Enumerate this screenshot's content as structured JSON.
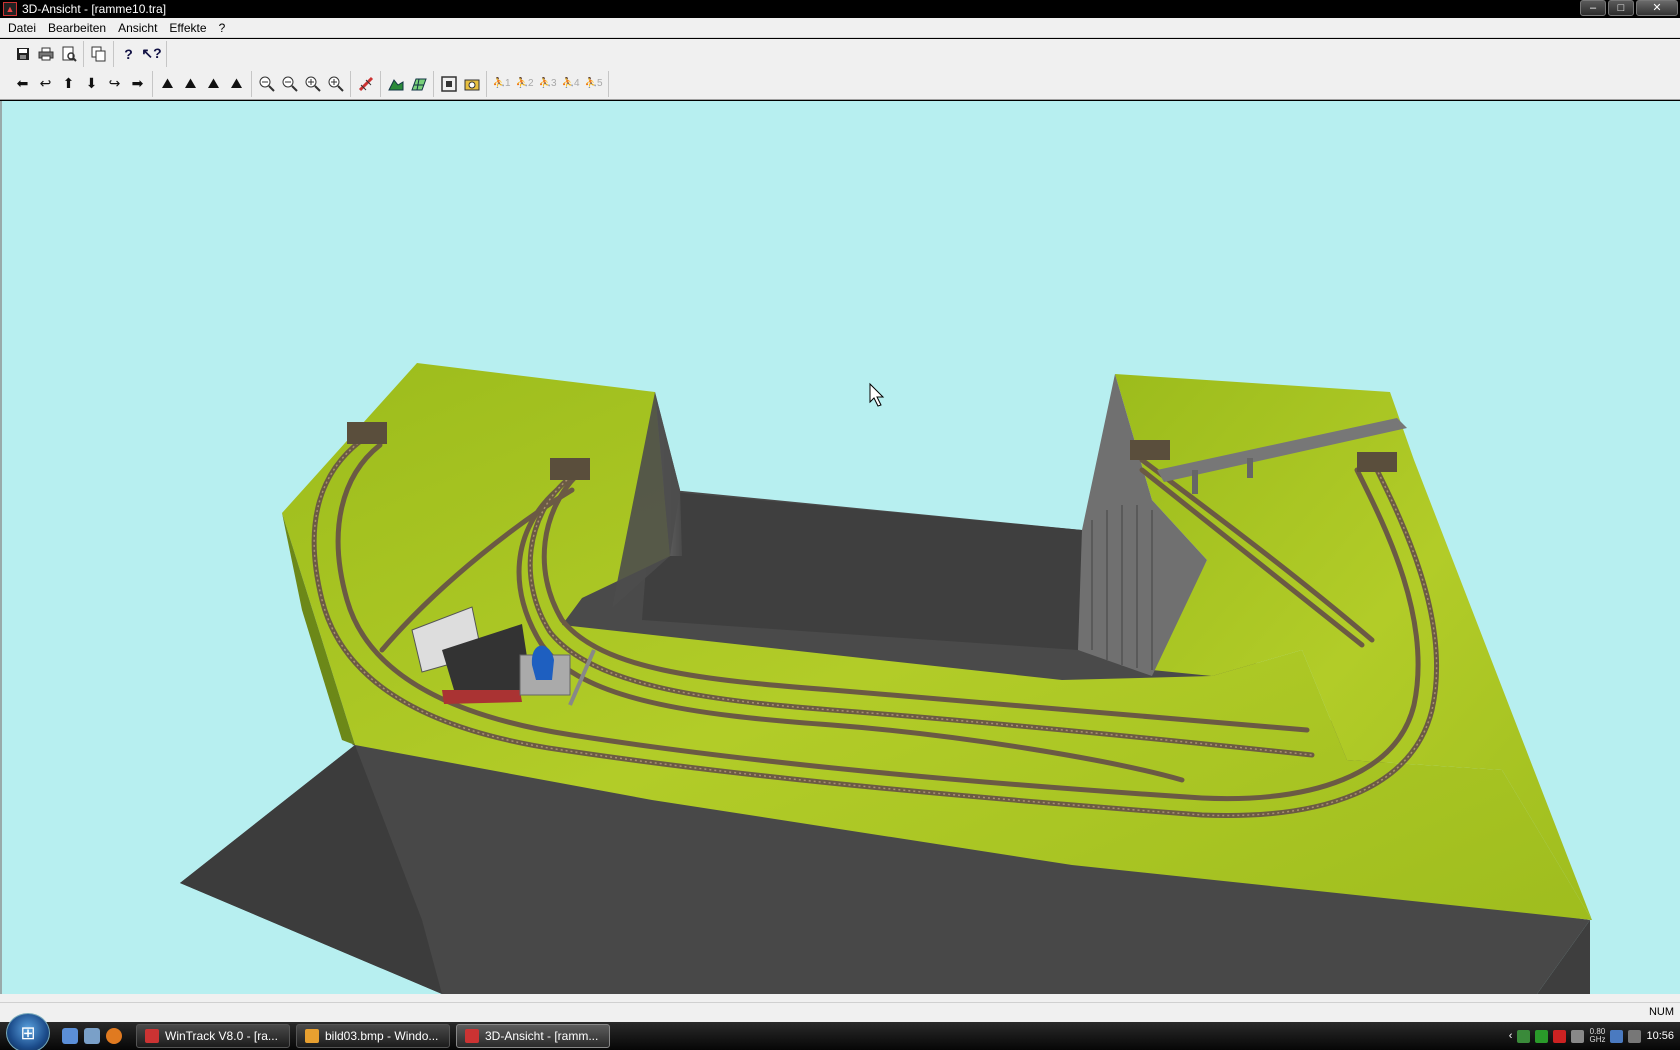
{
  "window": {
    "title": "3D-Ansicht - [ramme10.tra]",
    "buttons": {
      "minimize": "–",
      "maximize": "□",
      "close": "✕"
    }
  },
  "menu": [
    "Datei",
    "Bearbeiten",
    "Ansicht",
    "Effekte",
    "?"
  ],
  "toolbar1": {
    "groups": [
      [
        "save-icon",
        "print-icon",
        "print-preview-icon"
      ],
      [
        "copy-icon"
      ],
      [
        "help-icon",
        "context-help-icon"
      ]
    ]
  },
  "toolbar2": {
    "groups": [
      [
        "arrow-left-icon",
        "rotate-left-icon",
        "arrow-up-icon",
        "arrow-down-icon",
        "rotate-right-icon",
        "arrow-right-icon"
      ],
      [
        "camera-tilt-1-icon",
        "camera-tilt-2-icon",
        "camera-tilt-3-icon",
        "camera-tilt-4-icon"
      ],
      [
        "zoom-out-all-icon",
        "zoom-out-icon",
        "zoom-in-icon",
        "zoom-in-all-icon"
      ],
      [
        "track-icon"
      ],
      [
        "terrain-icon",
        "grid-icon"
      ],
      [
        "fit-view-icon",
        "snapshot-icon"
      ]
    ],
    "camera_positions": [
      "1",
      "2",
      "3",
      "4",
      "5"
    ]
  },
  "statusbar": {
    "num": "NUM"
  },
  "taskbar": {
    "tasks": [
      {
        "label": "WinTrack  V8.0 - [ra...",
        "icon_color": "#c33"
      },
      {
        "label": "bild03.bmp - Windo...",
        "icon_color": "#e8a030"
      },
      {
        "label": "3D-Ansicht - [ramm...",
        "icon_color": "#c33",
        "active": true
      }
    ],
    "clock": "10:56",
    "cpu": {
      "value": "0.80",
      "unit": "GHz"
    }
  },
  "colors": {
    "sky": "#b7eff0",
    "grass": "#a6c42a",
    "base": "#474747",
    "track": "#6b5a44"
  }
}
